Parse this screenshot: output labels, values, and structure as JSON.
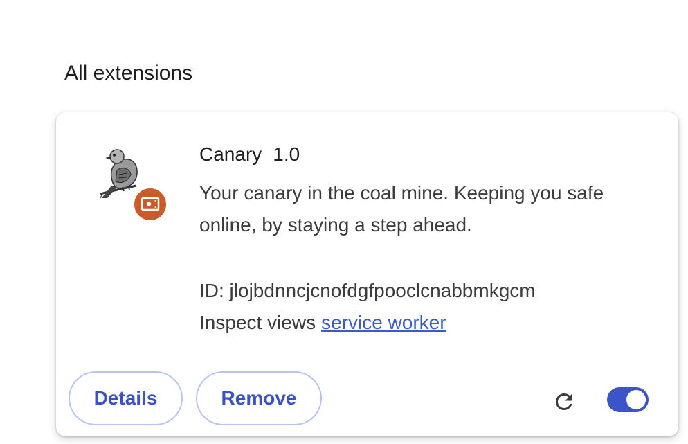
{
  "section": {
    "title": "All extensions"
  },
  "extension": {
    "name": "Canary",
    "version": "1.0",
    "description": "Your canary in the coal mine. Keeping you safe online, by staying a step ahead.",
    "id_text": "ID: jlojbdnncjcnofdgfpooclcnabbmkgcm",
    "inspect_label": "Inspect views",
    "inspect_link": "service worker",
    "icon": "canary-bird-icon",
    "badge_icon": "disk-badge-icon",
    "enabled": true
  },
  "actions": {
    "details_label": "Details",
    "remove_label": "Remove",
    "reload_icon": "reload-icon",
    "toggle_icon": "enable-toggle"
  },
  "colors": {
    "accent": "#3b54c9",
    "badge": "#cc5a2a",
    "link": "#3b5bcc",
    "button_border": "#b6c4ee"
  }
}
